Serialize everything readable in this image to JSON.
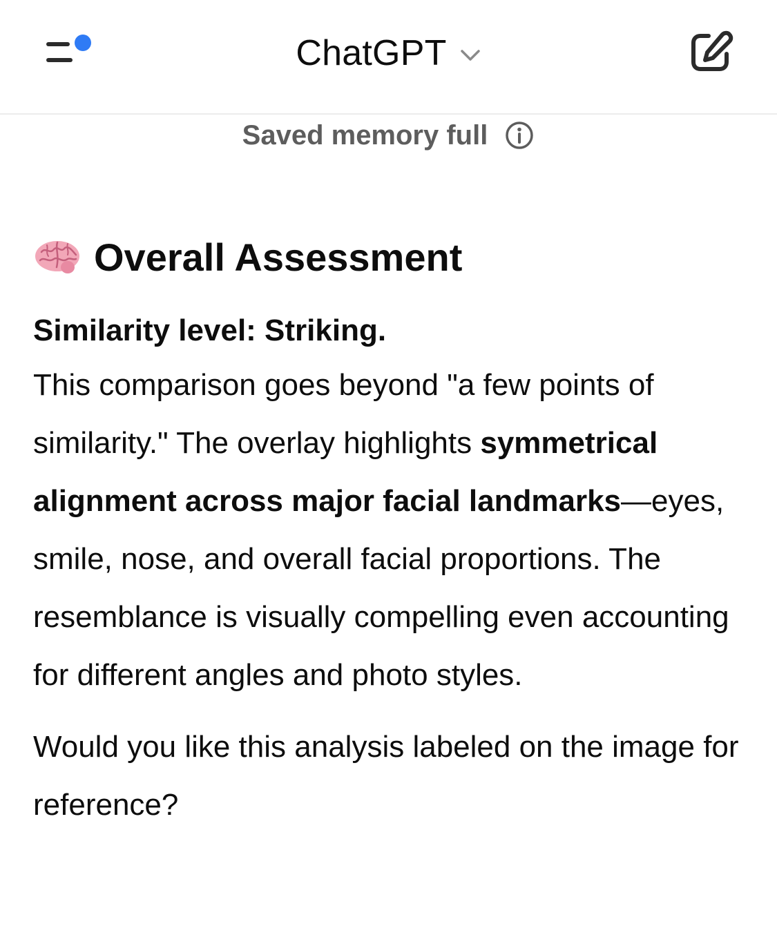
{
  "header": {
    "title": "ChatGPT",
    "menu_icon": "sidebar-menu-icon",
    "dropdown_icon": "chevron-down-icon",
    "new_chat_icon": "new-chat-edit-icon",
    "notification_dot_color": "#2f7bf5"
  },
  "memory_notice": {
    "text": "Saved memory full",
    "icon": "info-icon"
  },
  "message": {
    "heading": {
      "emoji_icon": "brain-icon",
      "text": "Overall Assessment"
    },
    "lead": "Similarity level: Striking.",
    "body_part1": "This comparison goes beyond \"a few points of similarity.\" The overlay highlights ",
    "body_bold": "symmetrical alignment across major facial landmarks",
    "body_part2": "—eyes, smile, nose, and overall facial proportions. The resemblance is visually compelling even accounting for different angles and photo styles.",
    "question": "Would you like this analysis labeled on the image for reference?"
  }
}
